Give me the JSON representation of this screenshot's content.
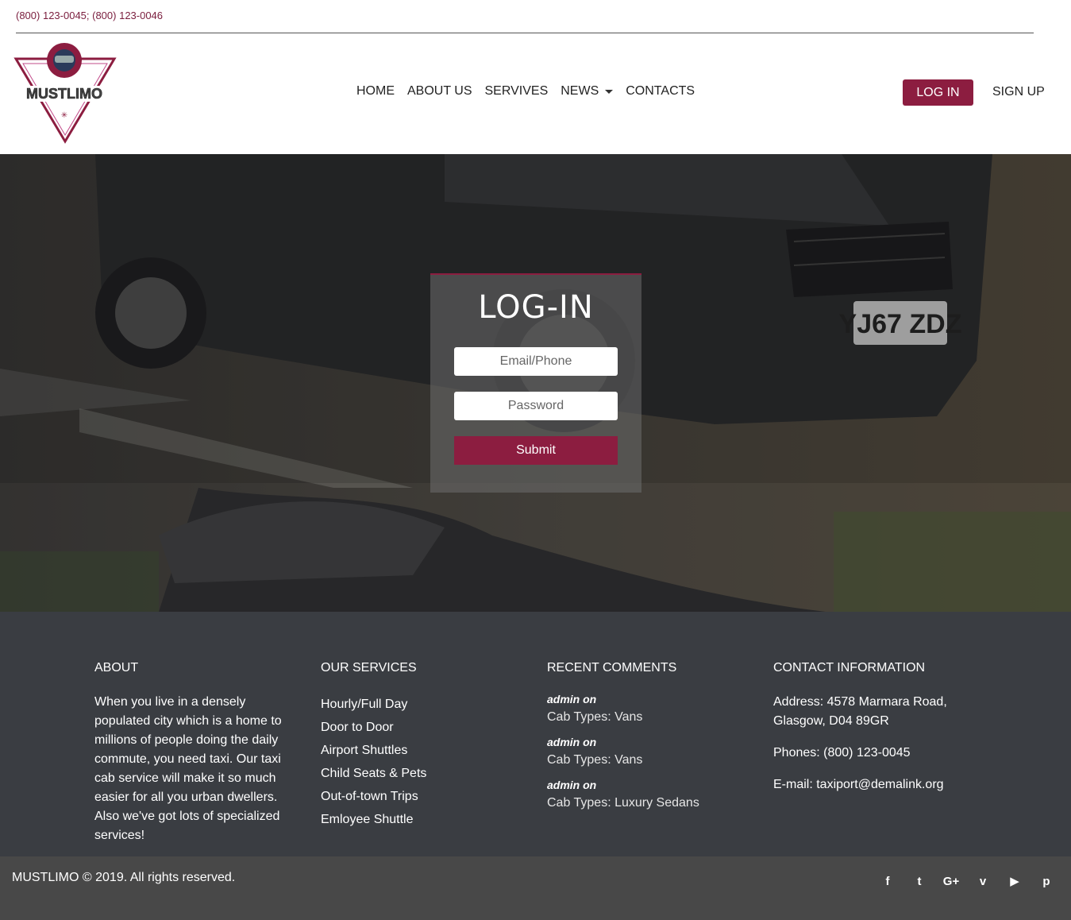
{
  "topbar": {
    "phones": "(800) 123-0045; (800) 123-0046"
  },
  "brand": {
    "logo_text": "MUSTLIMO",
    "accent": "#8c1d40"
  },
  "nav": {
    "items": [
      {
        "label": "HOME"
      },
      {
        "label": "ABOUT US"
      },
      {
        "label": "SERVIVES"
      },
      {
        "label": "NEWS"
      },
      {
        "label": "CONTACTS"
      }
    ],
    "login_label": "LOG IN",
    "signup_label": "SIGN UP"
  },
  "login": {
    "title": "LOG-IN",
    "email_placeholder": "Email/Phone",
    "password_placeholder": "Password",
    "submit_label": "Submit"
  },
  "footer": {
    "about": {
      "heading": "ABOUT",
      "text": "When you live in a densely populated city which is a home to millions of people doing the daily commute, you need taxi. Our taxi cab service will make it so much easier for all you urban dwellers. Also we've got lots of specialized services!"
    },
    "services": {
      "heading": "OUR SERVICES",
      "items": [
        "Hourly/Full Day",
        "Door to Door",
        "Airport Shuttles",
        "Child Seats & Pets",
        "Out-of-town Trips",
        "Emloyee Shuttle"
      ]
    },
    "comments": {
      "heading": "RECENT COMMENTS",
      "items": [
        {
          "by": "admin on",
          "text": "Cab Types: Vans"
        },
        {
          "by": "admin on",
          "text": "Cab Types: Vans"
        },
        {
          "by": "admin on",
          "text": "Cab Types: Luxury Sedans"
        }
      ]
    },
    "contact": {
      "heading": "CONTACT INFORMATION",
      "address": "Address: 4578 Marmara Road, Glasgow, D04 89GR",
      "phones": "Phones: (800) 123-0045",
      "email": "E-mail: taxiport@demalink.org"
    }
  },
  "bottom": {
    "copyright": "MUSTLIMO © 2019. All rights reserved.",
    "socials": [
      {
        "icon": "facebook-icon",
        "glyph": "f"
      },
      {
        "icon": "twitter-icon",
        "glyph": "t"
      },
      {
        "icon": "google-plus-icon",
        "glyph": "G+"
      },
      {
        "icon": "vimeo-icon",
        "glyph": "v"
      },
      {
        "icon": "youtube-icon",
        "glyph": "▶"
      },
      {
        "icon": "pinterest-icon",
        "glyph": "p"
      }
    ]
  }
}
